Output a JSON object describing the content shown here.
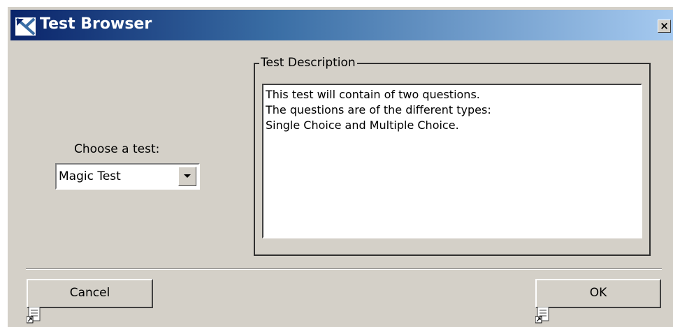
{
  "window": {
    "title": "Test Browser",
    "close_label": "×"
  },
  "chooser": {
    "label": "Choose a test:",
    "selected": "Magic Test"
  },
  "description": {
    "legend": "Test Description",
    "lines": [
      "This test will contain of two questions.",
      "The questions are of the different types:",
      "Single Choice and Multiple Choice."
    ]
  },
  "buttons": {
    "cancel": "Cancel",
    "ok": "OK"
  },
  "colors": {
    "titlebar_start": "#0a246a",
    "titlebar_end": "#a6caf0",
    "dialog_bg": "#d4d0c8"
  },
  "icons": {
    "title": "app-icon",
    "close": "close-icon",
    "combo_arrow": "chevron-down-icon",
    "button_badge": "document-shortcut-icon"
  }
}
